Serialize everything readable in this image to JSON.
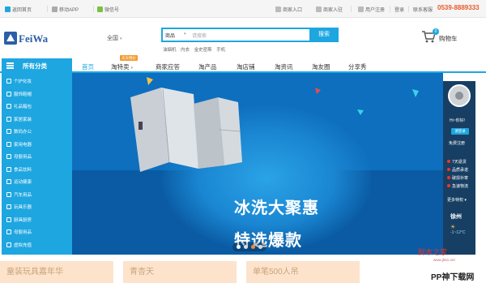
{
  "topbar": {
    "items": [
      "返回首页",
      "移动APP",
      "微信号",
      "商家入口",
      "商家入驻",
      "用户注册",
      "登录",
      "联系客服"
    ],
    "phone": "0539-8889333"
  },
  "header": {
    "logo_text": "FeiWa",
    "city": "全国",
    "search_category": "商品",
    "search_placeholder": "请搜索",
    "search_button": "搜索",
    "hot_words": [
      "油烟机",
      "内衣",
      "金史密斯",
      "手机"
    ],
    "cart_label": "购物车",
    "cart_count": "0"
  },
  "nav": {
    "all_categories": "所有分类",
    "items": [
      "首页",
      "淘特卖",
      "商家应答",
      "淘产品",
      "淘店铺",
      "淘资讯",
      "淘友圈",
      "分享秀"
    ],
    "badge": "天天特价"
  },
  "sidebar": {
    "items": [
      "个护化妆",
      "服饰鞋帽",
      "礼品箱包",
      "家居家装",
      "数码办公",
      "家用电器",
      "母婴用品",
      "食品饮料",
      "运动健康",
      "汽车用品",
      "玩具乐器",
      "厨具厨房",
      "母婴用品",
      "虚拟充值"
    ]
  },
  "banner": {
    "line1": "冰洗大聚惠",
    "line2": "特选爆款"
  },
  "right_panel": {
    "greeting": "Hi~你好!",
    "login": "请登录",
    "register": "免费注册",
    "links": [
      "7天退货",
      "品质承诺",
      "破损补寄",
      "急速物流"
    ],
    "more": "更多特权",
    "city": "徐州",
    "weather": "-1~12°C"
  },
  "bottom": {
    "cards": [
      "童装玩具嘉年华",
      "青杏天",
      "单笔500人吊"
    ]
  },
  "watermark": {
    "text1": "脚本之家",
    "url": "www.jb51.net",
    "text2": "PP神下载网"
  },
  "colors": {
    "accent": "#1ea6e0",
    "phone": "#e85a2a",
    "banner": "#0e6fbe",
    "badge": "#f39a33"
  }
}
